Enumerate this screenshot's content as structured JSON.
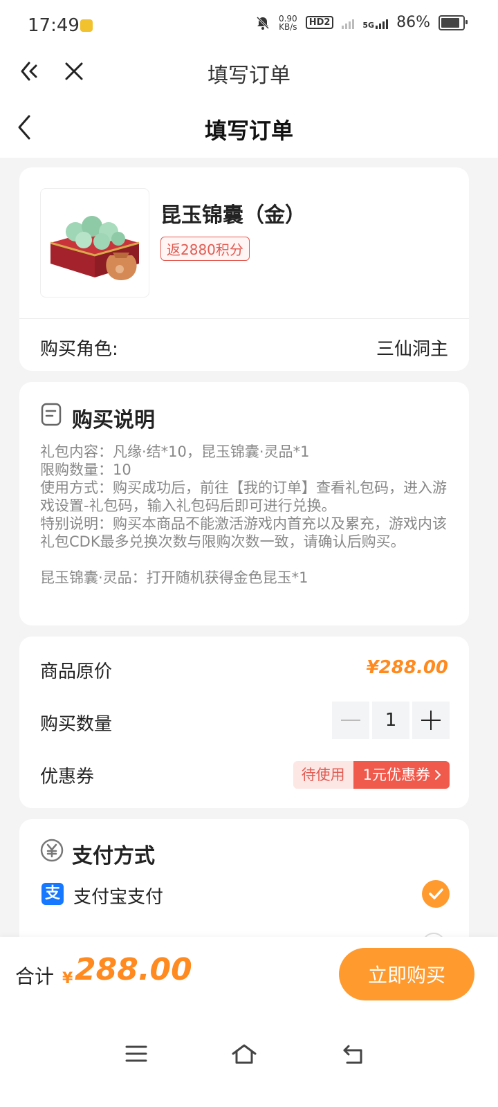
{
  "status_bar": {
    "time": "17:49",
    "speed_value": "0.90",
    "speed_unit": "KB/s",
    "hd_label": "HD2",
    "network_label": "5G",
    "battery": "86%"
  },
  "webview_nav": {
    "title": "填写订单"
  },
  "page_nav": {
    "title": "填写订单"
  },
  "product": {
    "name": "昆玉锦囊（金）",
    "points_tag": "返2880积分",
    "role_label": "购买角色:",
    "role_value": "三仙洞主"
  },
  "description": {
    "title": "购买说明",
    "lines": [
      "礼包内容：凡缘·结*10，昆玉锦囊·灵品*1",
      "限购数量：10",
      "使用方式：购买成功后，前往【我的订单】查看礼包码，进入游戏设置-礼包码，输入礼包码后即可进行兑换。",
      "特别说明：购买本商品不能激活游戏内首充以及累充，游戏内该礼包CDK最多兑换次数与限购次数一致，请确认后购买。",
      "昆玉锦囊·灵品：打开随机获得金色昆玉*1"
    ]
  },
  "pricing": {
    "original_price_label": "商品原价",
    "original_price": "¥288.00",
    "quantity_label": "购买数量",
    "quantity": "1",
    "coupon_label": "优惠券",
    "coupon_status": "待使用",
    "coupon_value": "1元优惠券"
  },
  "payment": {
    "title": "支付方式",
    "method": "支付宝支付"
  },
  "footer": {
    "total_label": "合计",
    "currency": "¥",
    "total_amount": "288.00",
    "buy_button": "立即购买"
  },
  "colors": {
    "accent": "#ff9a2e",
    "price": "#ff8a1f",
    "coupon_red": "#f05a4c",
    "alipay_blue": "#1677ff"
  }
}
